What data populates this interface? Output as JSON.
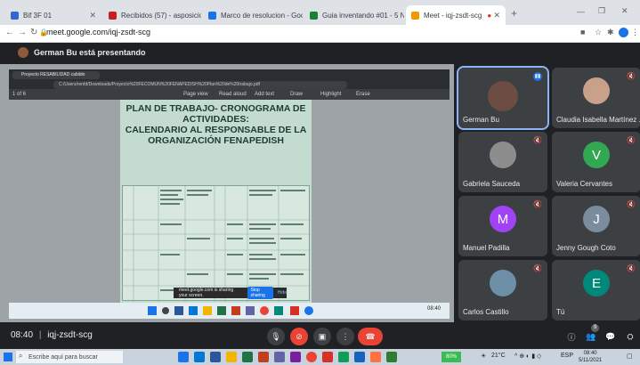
{
  "browser": {
    "tabs": [
      {
        "label": "Bif 3F 01",
        "color": "#3367d6",
        "active": false
      },
      {
        "label": "Recibidos (57) - asposicion (7)",
        "color": "#c5221f",
        "active": false
      },
      {
        "label": "Marco de resolucion - Google",
        "color": "#1a73e8",
        "active": false
      },
      {
        "label": "Guia inventando #01 - 5 NOV",
        "color": "#188038",
        "active": false
      },
      {
        "label": "Meet - iqj-zsdt-scg",
        "color": "#f29900",
        "active": true
      }
    ],
    "new_tab": "+",
    "url": "meet.google.com/iqj-zsdt-scg"
  },
  "meet": {
    "presenting_text": "German Bu está presentando",
    "meeting_code": "iqj-zsdt-scg",
    "time": "08:40",
    "time_separator": "|"
  },
  "shared": {
    "inner_tab": "Proyecto RESABILIDAD cabildo",
    "file_path": "C:/Users/renfd/Downloads/Proyecto%20FECOMUN%20FENAPEDISH%20Plan%20de%20trabajo.pdf",
    "pdf_tools": [
      "Page view",
      "Read aloud",
      "Add text",
      "Draw",
      "Highlight",
      "Erase"
    ],
    "pdf_page_label": "1 of 6",
    "pdf_title_lines": [
      "PLAN DE TRABAJO- CRONOGRAMA DE",
      "ACTIVIDADES:",
      "CALENDARIO AL RESPONSABLE DE LA",
      "ORGANIZACIÓN FENAPEDISH"
    ],
    "share_banner_text": "meet.google.com is sharing your screen.",
    "stop_sharing": "Stop sharing",
    "hide": "Hide"
  },
  "participants": [
    {
      "name": "German Bu",
      "initial": "",
      "color": "#6d4c41",
      "photo": true,
      "speaking": true,
      "muted": false
    },
    {
      "name": "Claudia Isabella Martínez ...",
      "initial": "",
      "color": "#c9a18a",
      "photo": true,
      "speaking": false,
      "muted": true
    },
    {
      "name": "Gabriela Sauceda",
      "initial": "",
      "color": "#8d8d8d",
      "photo": true,
      "speaking": false,
      "muted": true
    },
    {
      "name": "Valeria Cervantes",
      "initial": "V",
      "color": "#33a852",
      "photo": false,
      "speaking": false,
      "muted": true
    },
    {
      "name": "Manuel Padilla",
      "initial": "M",
      "color": "#a142f4",
      "photo": false,
      "speaking": false,
      "muted": true
    },
    {
      "name": "Jenny Gough Coto",
      "initial": "J",
      "color": "#7b8c9c",
      "photo": false,
      "speaking": false,
      "muted": true
    },
    {
      "name": "Carlos Castillo",
      "initial": "",
      "color": "#6e8fa8",
      "photo": true,
      "speaking": false,
      "muted": true
    },
    {
      "name": "Tú",
      "initial": "E",
      "color": "#00897b",
      "photo": false,
      "speaking": false,
      "muted": true
    }
  ],
  "controls": {
    "mic_icon": "mic-icon",
    "camera_icon": "camera-off-icon",
    "present_icon": "present-icon",
    "more_icon": "more-icon",
    "end_call_icon": "end-call-icon",
    "participants_count": "9"
  },
  "windows_taskbar": {
    "search_placeholder": "Escribe aquí para buscar",
    "battery": "80%",
    "weather": "21°C",
    "language": "ESP",
    "clock_time": "08:40",
    "clock_date": "5/11/2021"
  }
}
